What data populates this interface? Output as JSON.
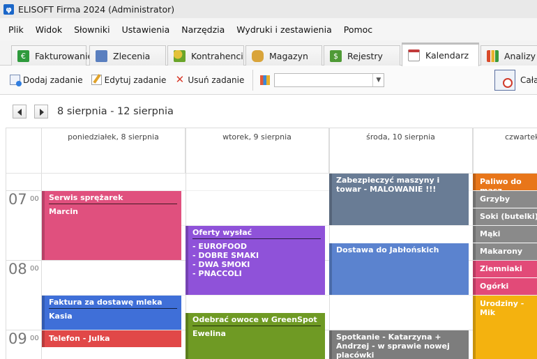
{
  "window": {
    "title": "ELISOFT Firma 2024 (Administrator)",
    "icon": "φ"
  },
  "menu": [
    "Plik",
    "Widok",
    "Słowniki",
    "Ustawienia",
    "Narzędzia",
    "Wydruki i zestawienia",
    "Pomoc"
  ],
  "tabs": [
    {
      "label": "Fakturowanie",
      "icon": "invoice-icon",
      "color": "#2e9a3c"
    },
    {
      "label": "Zlecenia",
      "icon": "orders-icon",
      "color": "#4b6fb0"
    },
    {
      "label": "Kontrahenci",
      "icon": "contacts-icon",
      "color": "#6aa52a"
    },
    {
      "label": "Magazyn",
      "icon": "warehouse-icon",
      "color": "#c28a1e"
    },
    {
      "label": "Rejestry",
      "icon": "registers-icon",
      "color": "#4f9a36"
    },
    {
      "label": "Kalendarz",
      "icon": "calendar-icon",
      "color": "#c23a3a"
    },
    {
      "label": "Analizy",
      "icon": "analytics-icon",
      "color": "#d94a2a"
    }
  ],
  "toolbar": {
    "add": "Dodaj zadanie",
    "edit": "Edytuj zadanie",
    "delete": "Usuń zadanie",
    "combo_value": "",
    "right_label": "Cała"
  },
  "range": "8 sierpnia - 12 sierpnia",
  "days": [
    "poniedziałek, 8 sierpnia",
    "wtorek, 9 sierpnia",
    "środa, 10 sierpnia",
    "czwartek"
  ],
  "hours": [
    {
      "hour": "07",
      "min": "00"
    },
    {
      "hour": "08",
      "min": "00"
    },
    {
      "hour": "09",
      "min": "00"
    }
  ],
  "events": {
    "e1": {
      "title": "Serwis sprężarek",
      "lines": [
        "Marcin"
      ],
      "color": "#e0507e"
    },
    "e2": {
      "title": "Faktura za dostawę mleka",
      "lines": [
        "Kasia"
      ],
      "color": "#3f6fd8"
    },
    "e3": {
      "title": "Telefon - Julka",
      "color": "#e14848"
    },
    "e4": {
      "title": "Oferty wysłać",
      "lines": [
        "- EUROFOOD",
        "- DOBRE SMAKI",
        "- DWA SMOKI",
        "- PNACCOLI"
      ],
      "color": "#8f52d9"
    },
    "e5": {
      "title": "Odebrać owoce w GreenSpot",
      "lines": [
        "Ewelina"
      ],
      "color": "#6f9a24"
    },
    "e6": {
      "title": "Zabezpieczyć maszyny i towar - MALOWANIE !!!",
      "color": "#697c95"
    },
    "e7": {
      "title": "Dostawa do Jabłońskich",
      "color": "#5b83cf"
    },
    "e8": {
      "title": "Spotkanie - Katarzyna + Andrzej - w sprawie nowej placówki",
      "color": "#7d7d7d"
    },
    "e9": {
      "title": "Paliwo do masz",
      "color": "#e8761a"
    },
    "e10": {
      "title": "Grzyby",
      "color": "#8a8a8a"
    },
    "e11": {
      "title": "Soki (butelki)",
      "color": "#8a8a8a"
    },
    "e12": {
      "title": "Mąki",
      "color": "#8a8a8a"
    },
    "e13": {
      "title": "Makarony",
      "color": "#8a8a8a"
    },
    "e14": {
      "title": "Ziemniaki",
      "color": "#e24a78"
    },
    "e15": {
      "title": "Ogórki",
      "color": "#e24a78"
    },
    "e16": {
      "title": "Urodziny - Mik",
      "color": "#f4b20f"
    }
  }
}
